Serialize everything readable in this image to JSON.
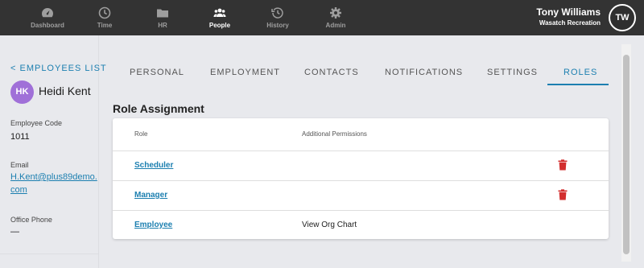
{
  "nav": {
    "items": [
      {
        "label": "Dashboard",
        "icon": "dashboard-icon"
      },
      {
        "label": "Time",
        "icon": "clock-icon"
      },
      {
        "label": "HR",
        "icon": "folder-icon"
      },
      {
        "label": "People",
        "icon": "people-icon"
      },
      {
        "label": "History",
        "icon": "history-icon"
      },
      {
        "label": "Admin",
        "icon": "gear-icon"
      }
    ],
    "active": "People"
  },
  "user": {
    "name": "Tony Williams",
    "org": "Wasatch Recreation",
    "initials": "TW"
  },
  "employee": {
    "back_label": "< EMPLOYEES LIST",
    "initials": "HK",
    "name": "Heidi Kent",
    "code_label": "Employee Code",
    "code": "1011",
    "email_label": "Email",
    "email": "H.Kent@plus89demo.com",
    "phone_label": "Office Phone",
    "phone": "—"
  },
  "tabs": [
    {
      "label": "PERSONAL"
    },
    {
      "label": "EMPLOYMENT"
    },
    {
      "label": "CONTACTS"
    },
    {
      "label": "NOTIFICATIONS"
    },
    {
      "label": "SETTINGS"
    },
    {
      "label": "ROLES"
    }
  ],
  "active_tab": "ROLES",
  "roles": {
    "title": "Role Assignment",
    "columns": {
      "role": "Role",
      "permissions": "Additional Permissions"
    },
    "rows": [
      {
        "role": "Scheduler",
        "permissions": "",
        "deletable": true
      },
      {
        "role": "Manager",
        "permissions": "",
        "deletable": true
      },
      {
        "role": "Employee",
        "permissions": "View Org Chart",
        "deletable": false
      }
    ]
  },
  "colors": {
    "accent": "#1c7fb0",
    "topbar": "#333333",
    "avatar_employee": "#a070d8",
    "delete": "#d32f2f"
  }
}
